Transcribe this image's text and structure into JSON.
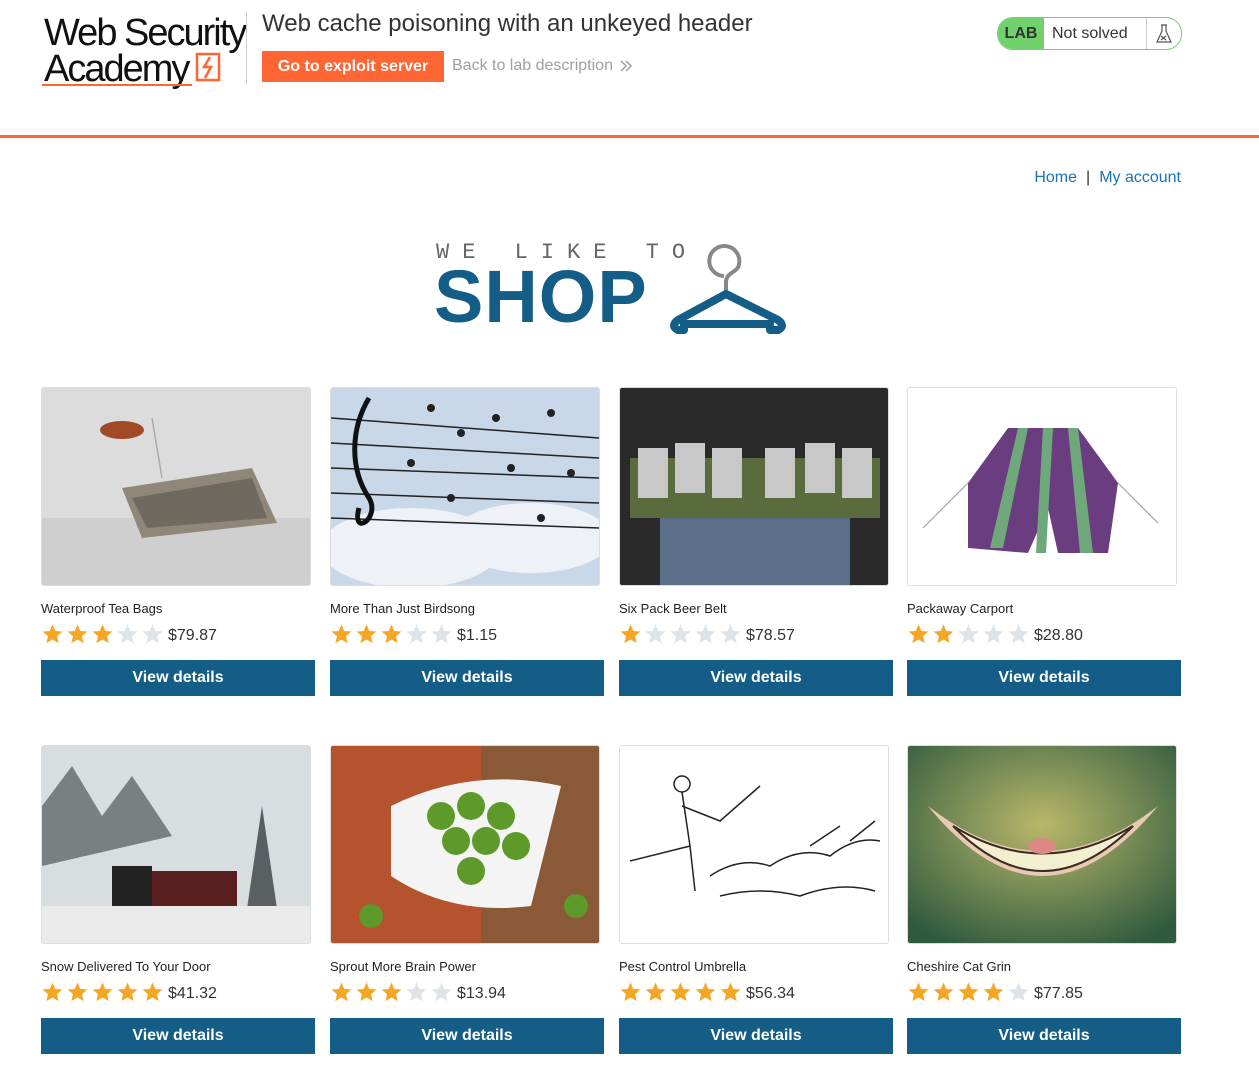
{
  "header": {
    "logo_line1": "Web Security",
    "logo_line2": "Academy",
    "lab_title": "Web cache poisoning with an unkeyed header",
    "exploit_button": "Go to exploit server",
    "back_link": "Back to lab description",
    "status_tag": "LAB",
    "status_text": "Not solved",
    "accent_color": "#ff6633",
    "status_color": "#70d16d"
  },
  "nav": {
    "home": "Home",
    "separator": "|",
    "account": "My account"
  },
  "banner": {
    "small": "WE LIKE TO",
    "big": "SHOP",
    "icon": "hanger-icon"
  },
  "products": [
    {
      "name": "Waterproof Tea Bags",
      "rating": 3,
      "price": "$79.87",
      "button": "View details"
    },
    {
      "name": "More Than Just Birdsong",
      "rating": 3,
      "price": "$1.15",
      "button": "View details"
    },
    {
      "name": "Six Pack Beer Belt",
      "rating": 1,
      "price": "$78.57",
      "button": "View details"
    },
    {
      "name": "Packaway Carport",
      "rating": 2,
      "price": "$28.80",
      "button": "View details"
    },
    {
      "name": "Snow Delivered To Your Door",
      "rating": 5,
      "price": "$41.32",
      "button": "View details"
    },
    {
      "name": "Sprout More Brain Power",
      "rating": 3,
      "price": "$13.94",
      "button": "View details"
    },
    {
      "name": "Pest Control Umbrella",
      "rating": 5,
      "price": "$56.34",
      "button": "View details"
    },
    {
      "name": "Cheshire Cat Grin",
      "rating": 4,
      "price": "$77.85",
      "button": "View details"
    }
  ]
}
